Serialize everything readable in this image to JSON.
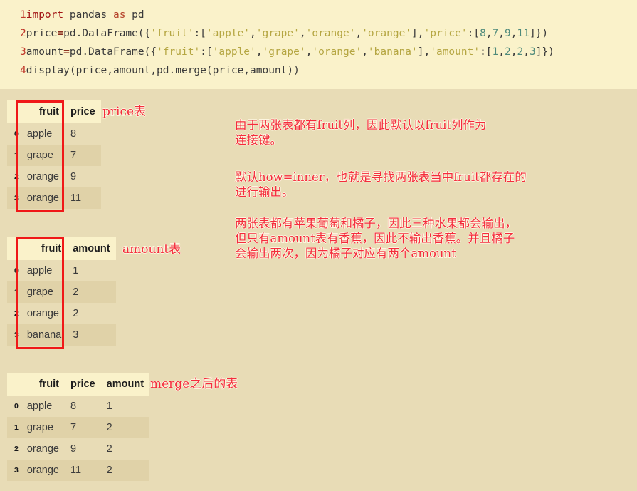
{
  "code": {
    "lines": [
      {
        "number": "1",
        "tokens": [
          {
            "t": "import",
            "c": "kw"
          },
          {
            "t": " pandas ",
            "c": "plain"
          },
          {
            "t": "as",
            "c": "kw2"
          },
          {
            "t": " pd",
            "c": "plain"
          }
        ]
      },
      {
        "number": "2",
        "tokens": [
          {
            "t": "price",
            "c": "plain"
          },
          {
            "t": "=",
            "c": "op"
          },
          {
            "t": "pd.DataFrame({",
            "c": "plain"
          },
          {
            "t": "'fruit'",
            "c": "str"
          },
          {
            "t": ":[",
            "c": "plain"
          },
          {
            "t": "'apple'",
            "c": "str"
          },
          {
            "t": ",",
            "c": "plain"
          },
          {
            "t": "'grape'",
            "c": "str"
          },
          {
            "t": ",",
            "c": "plain"
          },
          {
            "t": "'orange'",
            "c": "str"
          },
          {
            "t": ",",
            "c": "plain"
          },
          {
            "t": "'orange'",
            "c": "str"
          },
          {
            "t": "],",
            "c": "plain"
          },
          {
            "t": "'price'",
            "c": "str"
          },
          {
            "t": ":[",
            "c": "plain"
          },
          {
            "t": "8",
            "c": "num"
          },
          {
            "t": ",",
            "c": "plain"
          },
          {
            "t": "7",
            "c": "num"
          },
          {
            "t": ",",
            "c": "plain"
          },
          {
            "t": "9",
            "c": "num"
          },
          {
            "t": ",",
            "c": "plain"
          },
          {
            "t": "11",
            "c": "num"
          },
          {
            "t": "]})",
            "c": "plain"
          }
        ]
      },
      {
        "number": "3",
        "tokens": [
          {
            "t": "amount",
            "c": "plain"
          },
          {
            "t": "=",
            "c": "op"
          },
          {
            "t": "pd.DataFrame({",
            "c": "plain"
          },
          {
            "t": "'fruit'",
            "c": "str"
          },
          {
            "t": ":[",
            "c": "plain"
          },
          {
            "t": "'apple'",
            "c": "str"
          },
          {
            "t": ",",
            "c": "plain"
          },
          {
            "t": "'grape'",
            "c": "str"
          },
          {
            "t": ",",
            "c": "plain"
          },
          {
            "t": "'orange'",
            "c": "str"
          },
          {
            "t": ",",
            "c": "plain"
          },
          {
            "t": "'banana'",
            "c": "str"
          },
          {
            "t": "],",
            "c": "plain"
          },
          {
            "t": "'amount'",
            "c": "str"
          },
          {
            "t": ":[",
            "c": "plain"
          },
          {
            "t": "1",
            "c": "num"
          },
          {
            "t": ",",
            "c": "plain"
          },
          {
            "t": "2",
            "c": "num"
          },
          {
            "t": ",",
            "c": "plain"
          },
          {
            "t": "2",
            "c": "num"
          },
          {
            "t": ",",
            "c": "plain"
          },
          {
            "t": "3",
            "c": "num"
          },
          {
            "t": "]})",
            "c": "plain"
          }
        ]
      },
      {
        "number": "4",
        "tokens": [
          {
            "t": "display(price,amount,pd.merge(price,amount))",
            "c": "plain"
          }
        ]
      }
    ]
  },
  "tables": [
    {
      "id": "price-table",
      "label": "price表",
      "columns": [
        "fruit",
        "price"
      ],
      "index": [
        "0",
        "1",
        "2",
        "3"
      ],
      "rows": [
        [
          "apple",
          "8"
        ],
        [
          "grape",
          "7"
        ],
        [
          "orange",
          "9"
        ],
        [
          "orange",
          "11"
        ]
      ]
    },
    {
      "id": "amount-table",
      "label": "amount表",
      "columns": [
        "fruit",
        "amount"
      ],
      "index": [
        "0",
        "1",
        "2",
        "3"
      ],
      "rows": [
        [
          "apple",
          "1"
        ],
        [
          "grape",
          "2"
        ],
        [
          "orange",
          "2"
        ],
        [
          "banana",
          "3"
        ]
      ]
    },
    {
      "id": "merge-table",
      "label": "merge之后的表",
      "columns": [
        "fruit",
        "price",
        "amount"
      ],
      "index": [
        "0",
        "1",
        "2",
        "3"
      ],
      "rows": [
        [
          "apple",
          "8",
          "1"
        ],
        [
          "grape",
          "7",
          "2"
        ],
        [
          "orange",
          "9",
          "2"
        ],
        [
          "orange",
          "11",
          "2"
        ]
      ]
    }
  ],
  "annotations": {
    "note1": "由于两张表都有fruit列，因此默认以fruit列作为\n连接键。",
    "note2": "默认how=inner，也就是寻找两张表当中fruit都存在的\n进行输出。",
    "note3": "两张表都有苹果葡萄和橘子，因此三种水果都会输出，\n但只有amount表有香蕉，因此不输出香蕉。并且橘子\n会输出两次，因为橘子对应有两个amount"
  },
  "colors": {
    "page_background": "#e8dcb6",
    "code_background": "#faf2ca",
    "table_header_background": "#faf2ca",
    "table_row_alt_background": "#e0d2a8",
    "annotation_red": "#f42c3c",
    "highlight_box_red": "#f01818",
    "code_string": "#b5a642",
    "code_keyword": "#a31515",
    "code_number": "#4e8a7a",
    "code_linenumber": "#c0392b"
  }
}
